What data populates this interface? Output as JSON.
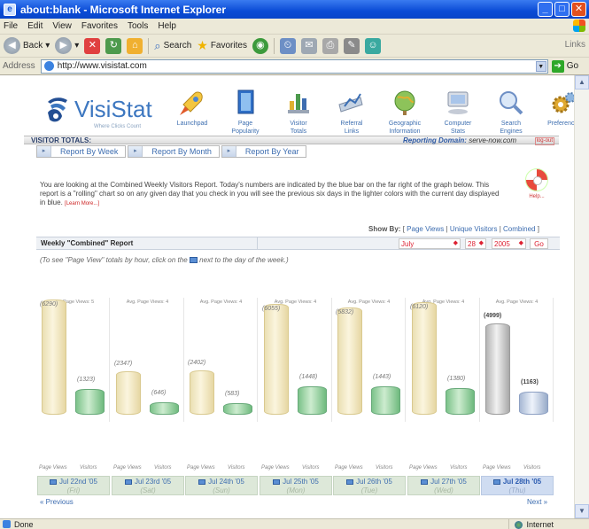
{
  "window": {
    "title": "about:blank - Microsoft Internet Explorer"
  },
  "menu": [
    "File",
    "Edit",
    "View",
    "Favorites",
    "Tools",
    "Help"
  ],
  "toolbar": {
    "back": "Back",
    "search": "Search",
    "favorites": "Favorites",
    "links": "Links"
  },
  "address": {
    "label": "Address",
    "url": "http://www.visistat.com",
    "go": "Go"
  },
  "status": {
    "text": "Done",
    "zone": "Internet"
  },
  "logo": {
    "brand": "VisiStat",
    "tagline": "Where Clicks Count"
  },
  "nav": [
    {
      "label": "Launchpad",
      "icon": "rocket-icon"
    },
    {
      "label": "Page\nPopularity",
      "icon": "book-icon"
    },
    {
      "label": "Visitor\nTotals",
      "icon": "bar-chart-icon"
    },
    {
      "label": "Referral\nLinks",
      "icon": "chart-board-icon"
    },
    {
      "label": "Geographic\nInformation",
      "icon": "globe-icon"
    },
    {
      "label": "Computer\nStats",
      "icon": "computer-icon"
    },
    {
      "label": "Search\nEngines",
      "icon": "magnifier-icon"
    },
    {
      "label": "Preferences",
      "icon": "gears-icon"
    }
  ],
  "totals": {
    "label": "VISITOR TOTALS:",
    "domain_label": "Reporting Domain:",
    "domain": "serve-now.com",
    "logout": "log-out"
  },
  "tabs": [
    "Report By Week",
    "Report By Month",
    "Report By Year"
  ],
  "intro": {
    "text": "You are looking at the Combined Weekly Visitors Report. Today's numbers are indicated by the blue bar on the far right of the graph below. This report is a \"rolling\" chart so on any given day that you check in you will see the previous six days in the lighter colors with the current day displayed in blue.",
    "learn_more": "[Learn More...]",
    "help": "Help..."
  },
  "showby": {
    "label": "Show By:",
    "open": "[",
    "page_views": "Page Views",
    "sep1": "|",
    "unique": "Unique Visitors",
    "sep2": "|",
    "combined": "Combined",
    "close": "]"
  },
  "report": {
    "title": "Weekly \"Combined\" Report",
    "month": "July",
    "day": "28",
    "year": "2005",
    "go": "Go"
  },
  "hint": {
    "before": "(To see \"Page View\" totals by hour, click on the",
    "after": "next to the day of the week.)"
  },
  "chart_data": {
    "type": "bar",
    "categories": [
      "Jul 22nd '05",
      "Jul 23rd '05",
      "Jul 24th '05",
      "Jul 25th '05",
      "Jul 26th '05",
      "Jul 27th '05",
      "Jul 28th '05"
    ],
    "weekdays": [
      "(Fri)",
      "(Sat)",
      "(Sun)",
      "(Mon)",
      "(Tue)",
      "(Wed)",
      "(Thu)"
    ],
    "avg": [
      "Avg. Page Views: 5",
      "Avg. Page Views: 4",
      "Avg. Page Views: 4",
      "Avg. Page Views: 4",
      "Avg. Page Views: 4",
      "Avg. Page Views: 4",
      "Avg. Page Views: 4"
    ],
    "series": [
      {
        "name": "Page Views",
        "values": [
          6290,
          2347,
          2402,
          6055,
          5832,
          6120,
          4999
        ]
      },
      {
        "name": "Visitors",
        "values": [
          1323,
          646,
          583,
          1448,
          1443,
          1380,
          1163
        ]
      }
    ],
    "today_index": 6
  },
  "pager": {
    "previous": "« Previous",
    "next": "Next »"
  }
}
